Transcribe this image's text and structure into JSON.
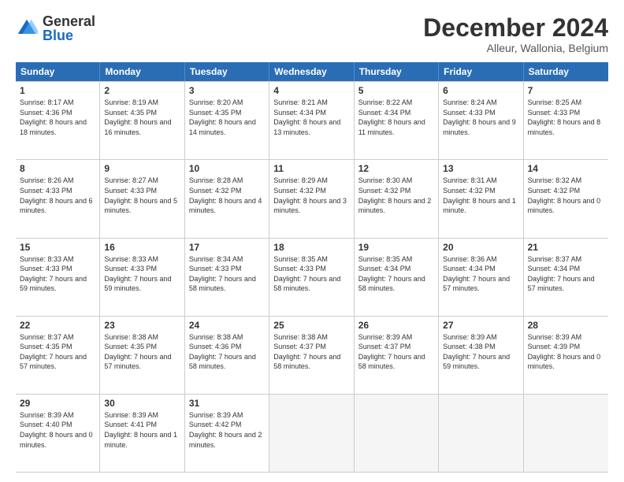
{
  "logo": {
    "general": "General",
    "blue": "Blue"
  },
  "title": "December 2024",
  "subtitle": "Alleur, Wallonia, Belgium",
  "days": [
    "Sunday",
    "Monday",
    "Tuesday",
    "Wednesday",
    "Thursday",
    "Friday",
    "Saturday"
  ],
  "weeks": [
    [
      {
        "day": "1",
        "sunrise": "8:17 AM",
        "sunset": "4:36 PM",
        "daylight": "8 hours and 18 minutes."
      },
      {
        "day": "2",
        "sunrise": "8:19 AM",
        "sunset": "4:35 PM",
        "daylight": "8 hours and 16 minutes."
      },
      {
        "day": "3",
        "sunrise": "8:20 AM",
        "sunset": "4:35 PM",
        "daylight": "8 hours and 14 minutes."
      },
      {
        "day": "4",
        "sunrise": "8:21 AM",
        "sunset": "4:34 PM",
        "daylight": "8 hours and 13 minutes."
      },
      {
        "day": "5",
        "sunrise": "8:22 AM",
        "sunset": "4:34 PM",
        "daylight": "8 hours and 11 minutes."
      },
      {
        "day": "6",
        "sunrise": "8:24 AM",
        "sunset": "4:33 PM",
        "daylight": "8 hours and 9 minutes."
      },
      {
        "day": "7",
        "sunrise": "8:25 AM",
        "sunset": "4:33 PM",
        "daylight": "8 hours and 8 minutes."
      }
    ],
    [
      {
        "day": "8",
        "sunrise": "8:26 AM",
        "sunset": "4:33 PM",
        "daylight": "8 hours and 6 minutes."
      },
      {
        "day": "9",
        "sunrise": "8:27 AM",
        "sunset": "4:33 PM",
        "daylight": "8 hours and 5 minutes."
      },
      {
        "day": "10",
        "sunrise": "8:28 AM",
        "sunset": "4:32 PM",
        "daylight": "8 hours and 4 minutes."
      },
      {
        "day": "11",
        "sunrise": "8:29 AM",
        "sunset": "4:32 PM",
        "daylight": "8 hours and 3 minutes."
      },
      {
        "day": "12",
        "sunrise": "8:30 AM",
        "sunset": "4:32 PM",
        "daylight": "8 hours and 2 minutes."
      },
      {
        "day": "13",
        "sunrise": "8:31 AM",
        "sunset": "4:32 PM",
        "daylight": "8 hours and 1 minute."
      },
      {
        "day": "14",
        "sunrise": "8:32 AM",
        "sunset": "4:32 PM",
        "daylight": "8 hours and 0 minutes."
      }
    ],
    [
      {
        "day": "15",
        "sunrise": "8:33 AM",
        "sunset": "4:33 PM",
        "daylight": "7 hours and 59 minutes."
      },
      {
        "day": "16",
        "sunrise": "8:33 AM",
        "sunset": "4:33 PM",
        "daylight": "7 hours and 59 minutes."
      },
      {
        "day": "17",
        "sunrise": "8:34 AM",
        "sunset": "4:33 PM",
        "daylight": "7 hours and 58 minutes."
      },
      {
        "day": "18",
        "sunrise": "8:35 AM",
        "sunset": "4:33 PM",
        "daylight": "7 hours and 58 minutes."
      },
      {
        "day": "19",
        "sunrise": "8:35 AM",
        "sunset": "4:34 PM",
        "daylight": "7 hours and 58 minutes."
      },
      {
        "day": "20",
        "sunrise": "8:36 AM",
        "sunset": "4:34 PM",
        "daylight": "7 hours and 57 minutes."
      },
      {
        "day": "21",
        "sunrise": "8:37 AM",
        "sunset": "4:34 PM",
        "daylight": "7 hours and 57 minutes."
      }
    ],
    [
      {
        "day": "22",
        "sunrise": "8:37 AM",
        "sunset": "4:35 PM",
        "daylight": "7 hours and 57 minutes."
      },
      {
        "day": "23",
        "sunrise": "8:38 AM",
        "sunset": "4:35 PM",
        "daylight": "7 hours and 57 minutes."
      },
      {
        "day": "24",
        "sunrise": "8:38 AM",
        "sunset": "4:36 PM",
        "daylight": "7 hours and 58 minutes."
      },
      {
        "day": "25",
        "sunrise": "8:38 AM",
        "sunset": "4:37 PM",
        "daylight": "7 hours and 58 minutes."
      },
      {
        "day": "26",
        "sunrise": "8:39 AM",
        "sunset": "4:37 PM",
        "daylight": "7 hours and 58 minutes."
      },
      {
        "day": "27",
        "sunrise": "8:39 AM",
        "sunset": "4:38 PM",
        "daylight": "7 hours and 59 minutes."
      },
      {
        "day": "28",
        "sunrise": "8:39 AM",
        "sunset": "4:39 PM",
        "daylight": "8 hours and 0 minutes."
      }
    ],
    [
      {
        "day": "29",
        "sunrise": "8:39 AM",
        "sunset": "4:40 PM",
        "daylight": "8 hours and 0 minutes."
      },
      {
        "day": "30",
        "sunrise": "8:39 AM",
        "sunset": "4:41 PM",
        "daylight": "8 hours and 1 minute."
      },
      {
        "day": "31",
        "sunrise": "8:39 AM",
        "sunset": "4:42 PM",
        "daylight": "8 hours and 2 minutes."
      },
      null,
      null,
      null,
      null
    ]
  ]
}
